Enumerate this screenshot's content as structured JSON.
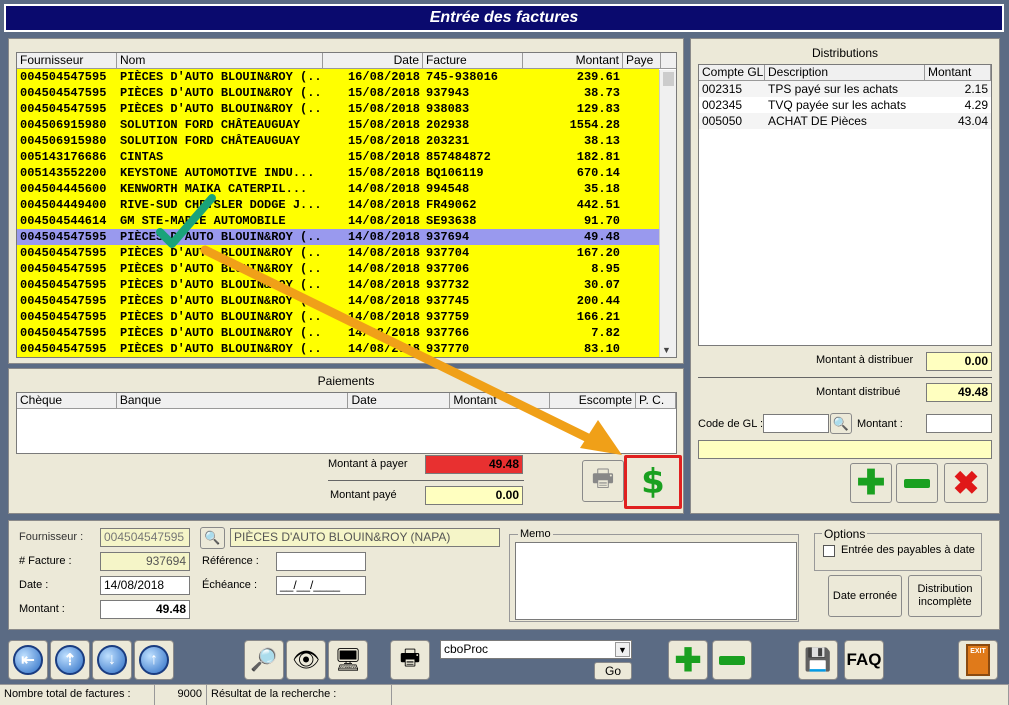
{
  "window": {
    "title": "Entrée des factures"
  },
  "invoices": {
    "headers": [
      "Fournisseur",
      "Nom",
      "Date",
      "Facture",
      "Montant",
      "Paye"
    ],
    "rows": [
      [
        "004504547595",
        "PIÈCES D'AUTO BLOUIN&ROY (...",
        "16/08/2018",
        "745-938016",
        "239.61"
      ],
      [
        "004504547595",
        "PIÈCES D'AUTO BLOUIN&ROY (...",
        "15/08/2018",
        "937943",
        "38.73"
      ],
      [
        "004504547595",
        "PIÈCES D'AUTO BLOUIN&ROY (...",
        "15/08/2018",
        "938083",
        "129.83"
      ],
      [
        "004506915980",
        "SOLUTION FORD CHÂTEAUGUAY",
        "15/08/2018",
        "202938",
        "1554.28"
      ],
      [
        "004506915980",
        "SOLUTION FORD CHÂTEAUGUAY",
        "15/08/2018",
        "203231",
        "38.13"
      ],
      [
        "005143176686",
        "CINTAS",
        "15/08/2018",
        "857484872",
        "182.81"
      ],
      [
        "005143552200",
        "KEYSTONE AUTOMOTIVE INDU...",
        "15/08/2018",
        "BQ106119",
        "670.14"
      ],
      [
        "004504445600",
        "KENWORTH MAIKA CATERPIL...",
        "14/08/2018",
        "994548",
        "35.18"
      ],
      [
        "004504449400",
        "RIVE-SUD CHRYSLER DODGE J...",
        "14/08/2018",
        "FR49062",
        "442.51"
      ],
      [
        "004504544614",
        "GM STE-MARIE AUTOMOBILE",
        "14/08/2018",
        "SE93638",
        "91.70"
      ],
      [
        "004504547595",
        "PIÈCES D'AUTO BLOUIN&ROY (...",
        "14/08/2018",
        "937694",
        "49.48"
      ],
      [
        "004504547595",
        "PIÈCES D'AUTO BLOUIN&ROY (...",
        "14/08/2018",
        "937704",
        "167.20"
      ],
      [
        "004504547595",
        "PIÈCES D'AUTO BLOUIN&ROY (...",
        "14/08/2018",
        "937706",
        "8.95"
      ],
      [
        "004504547595",
        "PIÈCES D'AUTO BLOUIN&ROY (...",
        "14/08/2018",
        "937732",
        "30.07"
      ],
      [
        "004504547595",
        "PIÈCES D'AUTO BLOUIN&ROY (...",
        "14/08/2018",
        "937745",
        "200.44"
      ],
      [
        "004504547595",
        "PIÈCES D'AUTO BLOUIN&ROY (...",
        "14/08/2018",
        "937759",
        "166.21"
      ],
      [
        "004504547595",
        "PIÈCES D'AUTO BLOUIN&ROY (...",
        "14/08/2018",
        "937766",
        "7.82"
      ],
      [
        "004504547595",
        "PIÈCES D'AUTO BLOUIN&ROY (...",
        "14/08/2018",
        "937770",
        "83.10"
      ]
    ],
    "selected_index": 10,
    "row_color": "#ffff00",
    "selected_color": "#9999ee"
  },
  "distributions": {
    "title": "Distributions",
    "headers": [
      "Compte GL",
      "Description",
      "Montant"
    ],
    "rows": [
      [
        "002315",
        "TPS payé sur les achats",
        "2.15"
      ],
      [
        "002345",
        "TVQ payée sur les achats",
        "4.29"
      ],
      [
        "005050",
        "ACHAT DE Pièces",
        "43.04"
      ]
    ],
    "montant_a_distribuer_label": "Montant à distribuer",
    "montant_a_distribuer": "0.00",
    "montant_distribue_label": "Montant distribué",
    "montant_distribue": "49.48",
    "code_gl_label": "Code de GL :",
    "montant_label": "Montant :"
  },
  "paiements": {
    "title": "Paiements",
    "headers": [
      "Chèque",
      "Banque",
      "Date",
      "Montant",
      "Escompte",
      "P. C."
    ],
    "montant_a_payer_label": "Montant à payer",
    "montant_a_payer": "49.48",
    "montant_paye_label": "Montant payé",
    "montant_paye": "0.00"
  },
  "detail": {
    "fournisseur_label": "Fournisseur :",
    "fournisseur_code": "004504547595",
    "fournisseur_nom": "PIÈCES D'AUTO BLOUIN&ROY (NAPA)",
    "facture_label": "# Facture :",
    "facture": "937694",
    "date_label": "Date :",
    "date": "14/08/2018",
    "montant_label": "Montant :",
    "montant": "49.48",
    "reference_label": "Référence :",
    "echeance_label": "Échéance :",
    "echeance": "__/__/____",
    "memo_label": "Memo"
  },
  "options": {
    "title": "Options",
    "checkbox_label": "Entrée des payables à date",
    "date_erronee": "Date erronée",
    "distribution_incomplete": "Distribution incomplète"
  },
  "toolbar": {
    "combo_value": "cboProc",
    "go_label": "Go",
    "faq_label": "FAQ",
    "exit_label": "EXIT"
  },
  "status": {
    "total_label": "Nombre total de factures :",
    "total_value": "9000",
    "search_label": "Résultat de la recherche :"
  }
}
